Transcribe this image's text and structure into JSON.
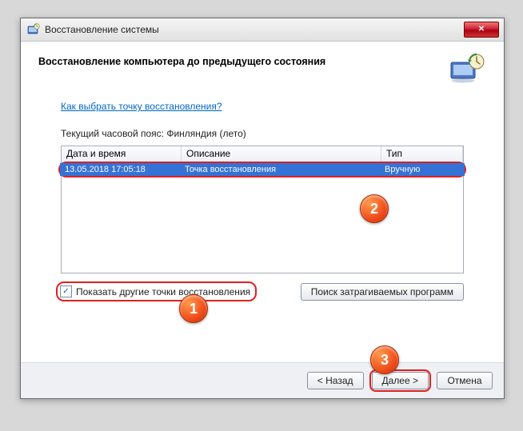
{
  "window": {
    "title": "Восстановление системы"
  },
  "header": {
    "title": "Восстановление компьютера до предыдущего состояния"
  },
  "help_link": "Как выбрать точку восстановления?",
  "timezone_label": "Текущий часовой пояс: Финляндия (лето)",
  "grid": {
    "columns": {
      "date": "Дата и время",
      "desc": "Описание",
      "type": "Тип"
    },
    "rows": [
      {
        "date": "13.05.2018 17:05:18",
        "desc": "Точка восстановления",
        "type": "Вручную"
      }
    ]
  },
  "checkbox": {
    "label": "Показать другие точки восстановления",
    "checked": true
  },
  "buttons": {
    "affected": "Поиск затрагиваемых программ",
    "back": "< Назад",
    "next": "Далее >",
    "cancel": "Отмена"
  },
  "markers": {
    "m1": "1",
    "m2": "2",
    "m3": "3"
  }
}
